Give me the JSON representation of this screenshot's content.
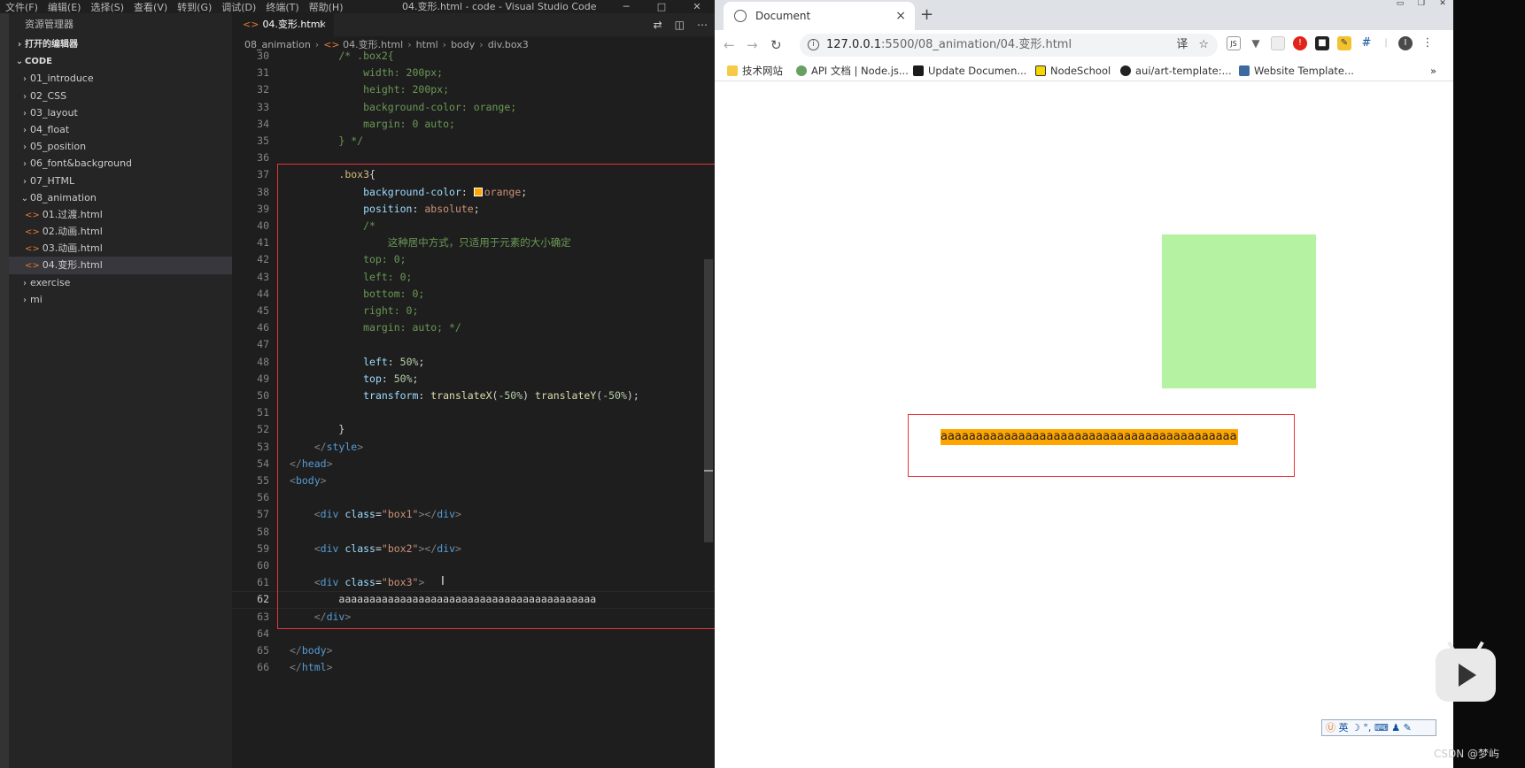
{
  "vscode": {
    "menu": [
      "文件(F)",
      "编辑(E)",
      "选择(S)",
      "查看(V)",
      "转到(G)",
      "调试(D)",
      "终端(T)",
      "帮助(H)"
    ],
    "window_title": "04.变形.html - code - Visual Studio Code",
    "win_controls": {
      "minimize": "─",
      "maximize": "□",
      "close": "✕"
    },
    "sidebar": {
      "title": "资源管理器",
      "open_editors": "打开的编辑器",
      "workspace": "CODE",
      "items": [
        {
          "label": "01_introduce",
          "type": "folder"
        },
        {
          "label": "02_CSS",
          "type": "folder"
        },
        {
          "label": "03_layout",
          "type": "folder"
        },
        {
          "label": "04_float",
          "type": "folder"
        },
        {
          "label": "05_position",
          "type": "folder"
        },
        {
          "label": "06_font&background",
          "type": "folder"
        },
        {
          "label": "07_HTML",
          "type": "folder"
        },
        {
          "label": "08_animation",
          "type": "folder-open"
        },
        {
          "label": "01.过渡.html",
          "type": "file"
        },
        {
          "label": "02.动画.html",
          "type": "file"
        },
        {
          "label": "03.动画.html",
          "type": "file"
        },
        {
          "label": "04.变形.html",
          "type": "file",
          "selected": true
        },
        {
          "label": "exercise",
          "type": "folder"
        },
        {
          "label": "mi",
          "type": "folder"
        }
      ]
    },
    "tab": {
      "label": "04.变形.html",
      "close": "×"
    },
    "tab_actions": [
      "⇄",
      "◫",
      "⋯"
    ],
    "breadcrumb": [
      "08_animation",
      "04.变形.html",
      "html",
      "body",
      "div.box3"
    ],
    "current_line": "62",
    "line_numbers": [
      "30",
      "31",
      "32",
      "33",
      "34",
      "35",
      "36",
      "37",
      "38",
      "39",
      "40",
      "41",
      "42",
      "43",
      "44",
      "45",
      "46",
      "47",
      "48",
      "49",
      "50",
      "51",
      "52",
      "53",
      "54",
      "55",
      "56",
      "57",
      "58",
      "59",
      "60",
      "61",
      "62",
      "63",
      "64",
      "65",
      "66"
    ]
  },
  "chrome": {
    "tab_title": "Document",
    "tab_close": "×",
    "new_tab": "+",
    "nav": {
      "back": "←",
      "forward": "→",
      "reload": "↻"
    },
    "url_host": "127.0.0.1",
    "url_path": ":5500/08_animation/04.变形.html",
    "omni_info": "i",
    "omni_icons": [
      "译",
      "☆"
    ],
    "bookmarks": [
      "技术网站",
      "API 文档 | Node.js...",
      "Update Documen...",
      "NodeSchool",
      "aui/art-template:...",
      "Website Template..."
    ],
    "bookmarks_more": "»",
    "page": {
      "text": "aaaaaaaaaaaaaaaaaaaaaaaaaaaaaaaaaaaaaaaaaa",
      "box1_color": "#b5f2a2",
      "box3_color": "#ffa500"
    },
    "ime": "英 ☽ °, ⌨ ♟ ✎"
  },
  "watermark": "CSDN @梦屿"
}
